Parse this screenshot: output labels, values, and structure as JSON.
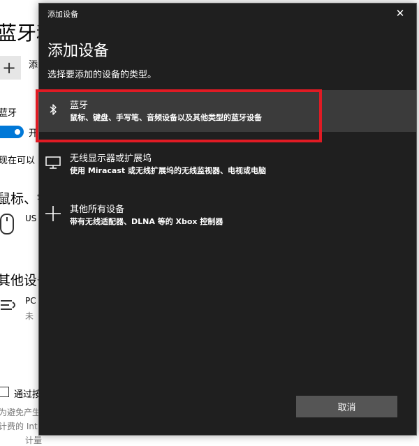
{
  "background": {
    "title": "蓝牙和",
    "add_label": "添",
    "bluetooth_label": "蓝牙",
    "toggle_state": "开",
    "discover_text": "现在可以",
    "section_mouse": "鼠标、键",
    "mouse_device": "US",
    "section_other": "其他设备",
    "other_device_name": "PC",
    "other_device_status": "未",
    "checkbox_label": "通过按",
    "fine_print_1": "为避免产生",
    "fine_print_2": "计费的 Int",
    "fine_print_3": "计量"
  },
  "dialog": {
    "window_title": "添加设备",
    "close_glyph": "✕",
    "heading": "添加设备",
    "subtitle": "选择要添加的设备的类型。",
    "options": [
      {
        "icon": "bluetooth-icon",
        "name": "蓝牙",
        "description": "鼠标、键盘、手写笔、音频设备以及其他类型的蓝牙设备"
      },
      {
        "icon": "monitor-icon",
        "name": "无线显示器或扩展坞",
        "description": "使用 Miracast 或无线扩展坞的无线监视器、电视或电脑"
      },
      {
        "icon": "plus-icon",
        "name": "其他所有设备",
        "description": "带有无线适配器、DLNA 等的 Xbox 控制器"
      }
    ],
    "cancel_label": "取消"
  },
  "colors": {
    "dialog_bg": "#1f1f1f",
    "selected_bg": "#3b3b3b",
    "highlight": "#e01b24",
    "accent": "#0078d7",
    "button_bg": "#555555"
  }
}
